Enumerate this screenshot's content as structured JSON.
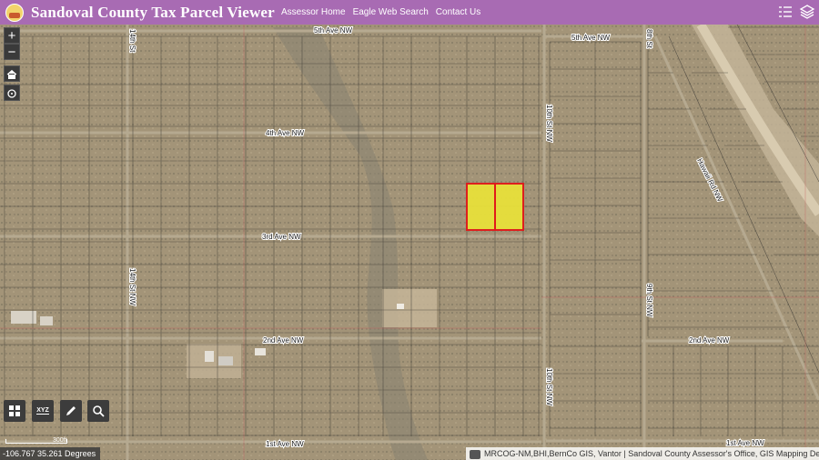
{
  "header": {
    "title": "Sandoval County Tax Parcel Viewer",
    "nav": [
      "Assessor Home",
      "Eagle Web Search",
      "Contact Us"
    ],
    "bg_color": "#a86bb3"
  },
  "map": {
    "streets": {
      "fifth_ave_west": "5th Ave NW",
      "fifth_ave_east": "5th Ave NW",
      "fourth_ave": "4th Ave NW",
      "third_ave": "3rd Ave NW",
      "second_ave_west": "2nd Ave NW",
      "second_ave_east": "2nd Ave NW",
      "first_ave_west": "1st Ave NW",
      "first_ave_east": "1st Ave NW",
      "fourteenth_st_north": "14th St",
      "fourteenth_st_south": "14th St NW",
      "tenth_st_north": "10th St NW",
      "tenth_st_south": "10th St NW",
      "ninth_st": "9th St NW",
      "eighth_st": "8th St",
      "diagonal_road": "Hawaii Rd NW"
    },
    "selected_parcel_fill": "#e8e03a",
    "selected_parcel_outline": "#e21a1a"
  },
  "controls": {
    "zoom_in": "+",
    "zoom_out": "−",
    "home_icon": "home-icon",
    "locate_icon": "locate-icon"
  },
  "toolbar": {
    "basemap_icon": "grid-icon",
    "coordinate_tool": "XYZ",
    "measure_icon": "pencil-icon",
    "search_icon": "search-icon"
  },
  "status": {
    "coordinates": "-106.767 35.261 Degrees",
    "scale_label": "300ft",
    "attribution": "MRCOG-NM,BHI,BernCo GIS, Vantor | Sandoval County Assessor's Office, GIS Mapping Department"
  }
}
